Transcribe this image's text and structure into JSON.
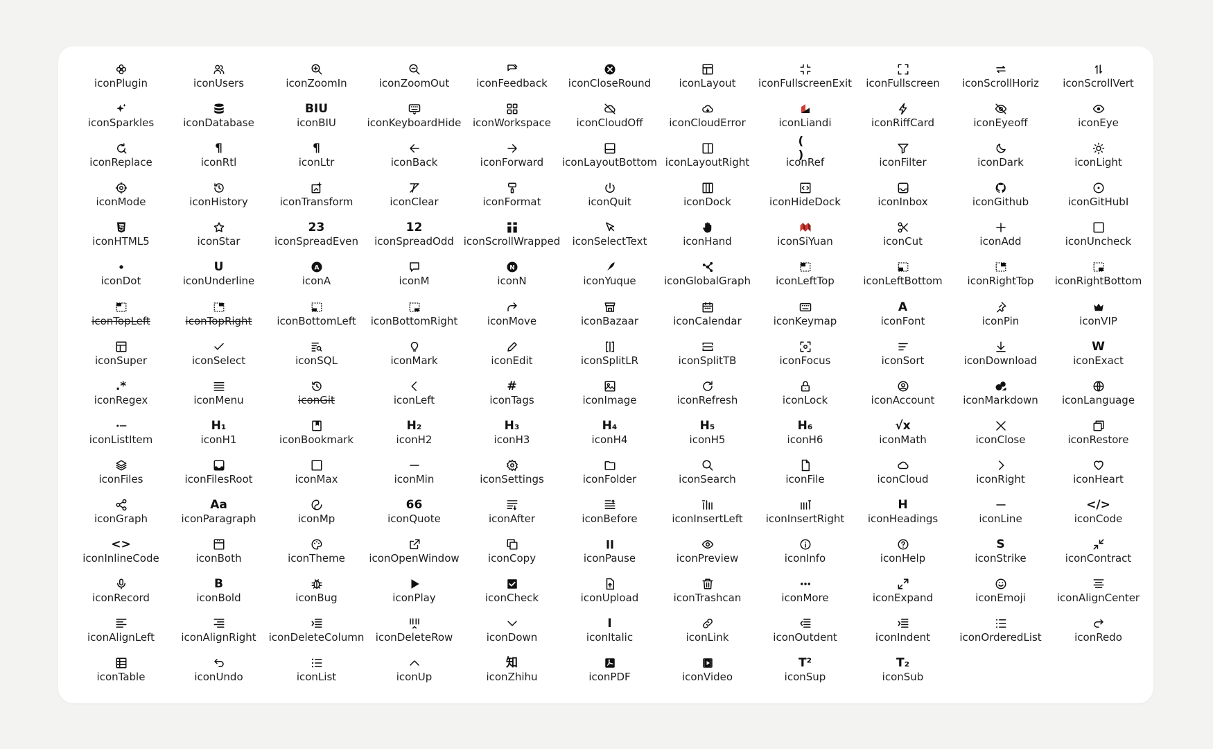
{
  "icons": [
    {
      "label": "iconPlugin",
      "icon": "plugin-icon"
    },
    {
      "label": "iconUsers",
      "icon": "users-icon"
    },
    {
      "label": "iconZoomIn",
      "icon": "zoom-in-icon"
    },
    {
      "label": "iconZoomOut",
      "icon": "zoom-out-icon"
    },
    {
      "label": "iconFeedback",
      "icon": "feedback-icon"
    },
    {
      "label": "iconCloseRound",
      "icon": "close-round-icon"
    },
    {
      "label": "iconLayout",
      "icon": "layout-icon"
    },
    {
      "label": "iconFullscreenExit",
      "icon": "fullscreen-exit-icon"
    },
    {
      "label": "iconFullscreen",
      "icon": "fullscreen-icon"
    },
    {
      "label": "iconScrollHoriz",
      "icon": "scroll-horiz-icon"
    },
    {
      "label": "iconScrollVert",
      "icon": "scroll-vert-icon"
    },
    {
      "label": "iconSparkles",
      "icon": "sparkles-icon"
    },
    {
      "label": "iconDatabase",
      "icon": "database-icon"
    },
    {
      "label": "iconBIU",
      "icon": "biu-icon",
      "glyph": "BIU"
    },
    {
      "label": "iconKeyboardHide",
      "icon": "keyboard-hide-icon"
    },
    {
      "label": "iconWorkspace",
      "icon": "workspace-icon"
    },
    {
      "label": "iconCloudOff",
      "icon": "cloud-off-icon"
    },
    {
      "label": "iconCloudError",
      "icon": "cloud-error-icon"
    },
    {
      "label": "iconLiandi",
      "icon": "liandi-icon"
    },
    {
      "label": "iconRiffCard",
      "icon": "riff-card-icon"
    },
    {
      "label": "iconEyeoff",
      "icon": "eye-off-icon"
    },
    {
      "label": "iconEye",
      "icon": "eye-icon"
    },
    {
      "label": "iconReplace",
      "icon": "replace-icon"
    },
    {
      "label": "iconRtl",
      "icon": "rtl-icon",
      "glyph": "¶"
    },
    {
      "label": "iconLtr",
      "icon": "ltr-icon",
      "glyph": "¶"
    },
    {
      "label": "iconBack",
      "icon": "back-icon"
    },
    {
      "label": "iconForward",
      "icon": "forward-icon"
    },
    {
      "label": "iconLayoutBottom",
      "icon": "layout-bottom-icon"
    },
    {
      "label": "iconLayoutRight",
      "icon": "layout-right-icon"
    },
    {
      "label": "iconRef",
      "icon": "ref-icon",
      "glyph": "( )"
    },
    {
      "label": "iconFilter",
      "icon": "filter-icon"
    },
    {
      "label": "iconDark",
      "icon": "dark-icon"
    },
    {
      "label": "iconLight",
      "icon": "light-icon"
    },
    {
      "label": "iconMode",
      "icon": "mode-icon"
    },
    {
      "label": "iconHistory",
      "icon": "history-icon"
    },
    {
      "label": "iconTransform",
      "icon": "transform-icon"
    },
    {
      "label": "iconClear",
      "icon": "clear-icon"
    },
    {
      "label": "iconFormat",
      "icon": "format-icon"
    },
    {
      "label": "iconQuit",
      "icon": "quit-icon"
    },
    {
      "label": "iconDock",
      "icon": "dock-icon"
    },
    {
      "label": "iconHideDock",
      "icon": "hide-dock-icon"
    },
    {
      "label": "iconInbox",
      "icon": "inbox-icon"
    },
    {
      "label": "iconGithub",
      "icon": "github-icon"
    },
    {
      "label": "iconGitHubI",
      "icon": "github-i-icon"
    },
    {
      "label": "iconHTML5",
      "icon": "html5-icon"
    },
    {
      "label": "iconStar",
      "icon": "star-icon"
    },
    {
      "label": "iconSpreadEven",
      "icon": "spread-even-icon",
      "glyph": "23"
    },
    {
      "label": "iconSpreadOdd",
      "icon": "spread-odd-icon",
      "glyph": "12"
    },
    {
      "label": "iconScrollWrapped",
      "icon": "scroll-wrapped-icon"
    },
    {
      "label": "iconSelectText",
      "icon": "select-text-icon"
    },
    {
      "label": "iconHand",
      "icon": "hand-icon"
    },
    {
      "label": "iconSiYuan",
      "icon": "siyuan-icon"
    },
    {
      "label": "iconCut",
      "icon": "cut-icon"
    },
    {
      "label": "iconAdd",
      "icon": "add-icon"
    },
    {
      "label": "iconUncheck",
      "icon": "uncheck-icon"
    },
    {
      "label": "iconDot",
      "icon": "dot-icon"
    },
    {
      "label": "iconUnderline",
      "icon": "underline-icon",
      "glyph": "U"
    },
    {
      "label": "iconA",
      "icon": "a-icon"
    },
    {
      "label": "iconM",
      "icon": "m-icon"
    },
    {
      "label": "iconN",
      "icon": "n-icon"
    },
    {
      "label": "iconYuque",
      "icon": "yuque-icon"
    },
    {
      "label": "iconGlobalGraph",
      "icon": "global-graph-icon"
    },
    {
      "label": "iconLeftTop",
      "icon": "left-top-icon"
    },
    {
      "label": "iconLeftBottom",
      "icon": "left-bottom-icon"
    },
    {
      "label": "iconRightTop",
      "icon": "right-top-icon"
    },
    {
      "label": "iconRightBottom",
      "icon": "right-bottom-icon"
    },
    {
      "label": "iconTopLeft",
      "icon": "top-left-icon",
      "strike": true
    },
    {
      "label": "iconTopRight",
      "icon": "top-right-icon",
      "strike": true
    },
    {
      "label": "iconBottomLeft",
      "icon": "bottom-left-icon"
    },
    {
      "label": "iconBottomRight",
      "icon": "bottom-right-icon"
    },
    {
      "label": "iconMove",
      "icon": "move-icon"
    },
    {
      "label": "iconBazaar",
      "icon": "bazaar-icon"
    },
    {
      "label": "iconCalendar",
      "icon": "calendar-icon"
    },
    {
      "label": "iconKeymap",
      "icon": "keymap-icon"
    },
    {
      "label": "iconFont",
      "icon": "font-icon",
      "glyph": "A"
    },
    {
      "label": "iconPin",
      "icon": "pin-icon"
    },
    {
      "label": "iconVIP",
      "icon": "vip-icon"
    },
    {
      "label": "iconSuper",
      "icon": "super-icon"
    },
    {
      "label": "iconSelect",
      "icon": "select-icon"
    },
    {
      "label": "iconSQL",
      "icon": "sql-icon"
    },
    {
      "label": "iconMark",
      "icon": "mark-icon"
    },
    {
      "label": "iconEdit",
      "icon": "edit-icon"
    },
    {
      "label": "iconSplitLR",
      "icon": "split-lr-icon"
    },
    {
      "label": "iconSplitTB",
      "icon": "split-tb-icon"
    },
    {
      "label": "iconFocus",
      "icon": "focus-icon"
    },
    {
      "label": "iconSort",
      "icon": "sort-icon"
    },
    {
      "label": "iconDownload",
      "icon": "download-icon"
    },
    {
      "label": "iconExact",
      "icon": "exact-icon",
      "glyph": "W"
    },
    {
      "label": "iconRegex",
      "icon": "regex-icon",
      "glyph": ".*"
    },
    {
      "label": "iconMenu",
      "icon": "menu-icon"
    },
    {
      "label": "iconGit",
      "icon": "git-icon",
      "strike": true
    },
    {
      "label": "iconLeft",
      "icon": "left-icon"
    },
    {
      "label": "iconTags",
      "icon": "tags-icon",
      "glyph": "#"
    },
    {
      "label": "iconImage",
      "icon": "image-icon"
    },
    {
      "label": "iconRefresh",
      "icon": "refresh-icon"
    },
    {
      "label": "iconLock",
      "icon": "lock-icon"
    },
    {
      "label": "iconAccount",
      "icon": "account-icon"
    },
    {
      "label": "iconMarkdown",
      "icon": "markdown-icon"
    },
    {
      "label": "iconLanguage",
      "icon": "language-icon"
    },
    {
      "label": "iconListItem",
      "icon": "list-item-icon"
    },
    {
      "label": "iconH1",
      "icon": "h1-icon",
      "glyph": "H₁"
    },
    {
      "label": "iconBookmark",
      "icon": "bookmark-icon"
    },
    {
      "label": "iconH2",
      "icon": "h2-icon",
      "glyph": "H₂"
    },
    {
      "label": "iconH3",
      "icon": "h3-icon",
      "glyph": "H₃"
    },
    {
      "label": "iconH4",
      "icon": "h4-icon",
      "glyph": "H₄"
    },
    {
      "label": "iconH5",
      "icon": "h5-icon",
      "glyph": "H₅"
    },
    {
      "label": "iconH6",
      "icon": "h6-icon",
      "glyph": "H₆"
    },
    {
      "label": "iconMath",
      "icon": "math-icon",
      "glyph": "√x"
    },
    {
      "label": "iconClose",
      "icon": "close-icon"
    },
    {
      "label": "iconRestore",
      "icon": "restore-icon"
    },
    {
      "label": "iconFiles",
      "icon": "files-icon"
    },
    {
      "label": "iconFilesRoot",
      "icon": "files-root-icon"
    },
    {
      "label": "iconMax",
      "icon": "max-icon"
    },
    {
      "label": "iconMin",
      "icon": "min-icon"
    },
    {
      "label": "iconSettings",
      "icon": "settings-icon"
    },
    {
      "label": "iconFolder",
      "icon": "folder-icon"
    },
    {
      "label": "iconSearch",
      "icon": "search-icon"
    },
    {
      "label": "iconFile",
      "icon": "file-icon"
    },
    {
      "label": "iconCloud",
      "icon": "cloud-icon"
    },
    {
      "label": "iconRight",
      "icon": "right-icon"
    },
    {
      "label": "iconHeart",
      "icon": "heart-icon"
    },
    {
      "label": "iconGraph",
      "icon": "graph-icon"
    },
    {
      "label": "iconParagraph",
      "icon": "paragraph-icon",
      "glyph": "Aa"
    },
    {
      "label": "iconMp",
      "icon": "mp-icon"
    },
    {
      "label": "iconQuote",
      "icon": "quote-icon",
      "glyph": "66"
    },
    {
      "label": "iconAfter",
      "icon": "after-icon"
    },
    {
      "label": "iconBefore",
      "icon": "before-icon"
    },
    {
      "label": "iconInsertLeft",
      "icon": "insert-left-icon"
    },
    {
      "label": "iconInsertRight",
      "icon": "insert-right-icon"
    },
    {
      "label": "iconHeadings",
      "icon": "headings-icon",
      "glyph": "H"
    },
    {
      "label": "iconLine",
      "icon": "line-icon"
    },
    {
      "label": "iconCode",
      "icon": "code-icon",
      "glyph": "</>"
    },
    {
      "label": "iconInlineCode",
      "icon": "inline-code-icon",
      "glyph": "<>"
    },
    {
      "label": "iconBoth",
      "icon": "both-icon"
    },
    {
      "label": "iconTheme",
      "icon": "theme-icon"
    },
    {
      "label": "iconOpenWindow",
      "icon": "open-window-icon"
    },
    {
      "label": "iconCopy",
      "icon": "copy-icon"
    },
    {
      "label": "iconPause",
      "icon": "pause-icon"
    },
    {
      "label": "iconPreview",
      "icon": "preview-icon"
    },
    {
      "label": "iconInfo",
      "icon": "info-icon"
    },
    {
      "label": "iconHelp",
      "icon": "help-icon"
    },
    {
      "label": "iconStrike",
      "icon": "strike-icon",
      "glyph": "S"
    },
    {
      "label": "iconContract",
      "icon": "contract-icon"
    },
    {
      "label": "iconRecord",
      "icon": "record-icon"
    },
    {
      "label": "iconBold",
      "icon": "bold-icon",
      "glyph": "B"
    },
    {
      "label": "iconBug",
      "icon": "bug-icon"
    },
    {
      "label": "iconPlay",
      "icon": "play-icon"
    },
    {
      "label": "iconCheck",
      "icon": "check-icon"
    },
    {
      "label": "iconUpload",
      "icon": "upload-icon"
    },
    {
      "label": "iconTrashcan",
      "icon": "trashcan-icon"
    },
    {
      "label": "iconMore",
      "icon": "more-icon"
    },
    {
      "label": "iconExpand",
      "icon": "expand-icon"
    },
    {
      "label": "iconEmoji",
      "icon": "emoji-icon"
    },
    {
      "label": "iconAlignCenter",
      "icon": "align-center-icon"
    },
    {
      "label": "iconAlignLeft",
      "icon": "align-left-icon"
    },
    {
      "label": "iconAlignRight",
      "icon": "align-right-icon"
    },
    {
      "label": "iconDeleteColumn",
      "icon": "delete-column-icon"
    },
    {
      "label": "iconDeleteRow",
      "icon": "delete-row-icon"
    },
    {
      "label": "iconDown",
      "icon": "down-icon"
    },
    {
      "label": "iconItalic",
      "icon": "italic-icon",
      "glyph": "I"
    },
    {
      "label": "iconLink",
      "icon": "link-icon"
    },
    {
      "label": "iconOutdent",
      "icon": "outdent-icon"
    },
    {
      "label": "iconIndent",
      "icon": "indent-icon"
    },
    {
      "label": "iconOrderedList",
      "icon": "ordered-list-icon"
    },
    {
      "label": "iconRedo",
      "icon": "redo-icon"
    },
    {
      "label": "iconTable",
      "icon": "table-icon"
    },
    {
      "label": "iconUndo",
      "icon": "undo-icon"
    },
    {
      "label": "iconList",
      "icon": "list-icon"
    },
    {
      "label": "iconUp",
      "icon": "up-icon"
    },
    {
      "label": "iconZhihu",
      "icon": "zhihu-icon",
      "glyph": "知"
    },
    {
      "label": "iconPDF",
      "icon": "pdf-icon"
    },
    {
      "label": "iconVideo",
      "icon": "video-icon"
    },
    {
      "label": "iconSup",
      "icon": "sup-icon",
      "glyph": "T²"
    },
    {
      "label": "iconSub",
      "icon": "sub-icon",
      "glyph": "T₂"
    }
  ]
}
